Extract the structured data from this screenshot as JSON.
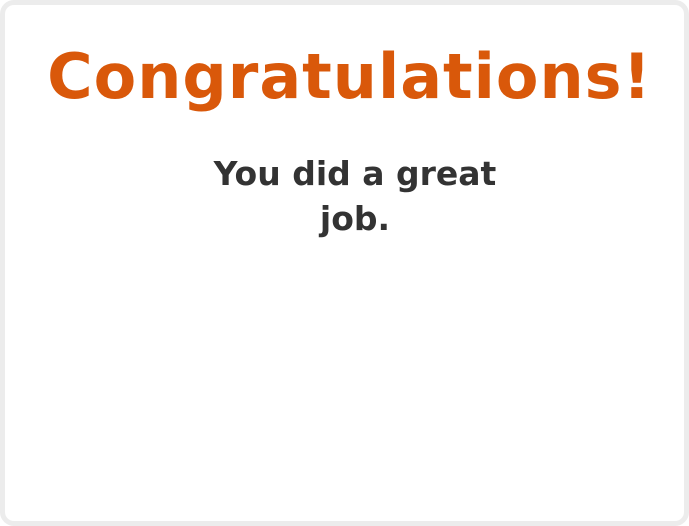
{
  "dialog": {
    "title": "Congratulations!",
    "message": "You did a great job."
  },
  "colors": {
    "title": "#d9580a",
    "message": "#333333",
    "border": "#ececec",
    "background": "#ffffff"
  }
}
